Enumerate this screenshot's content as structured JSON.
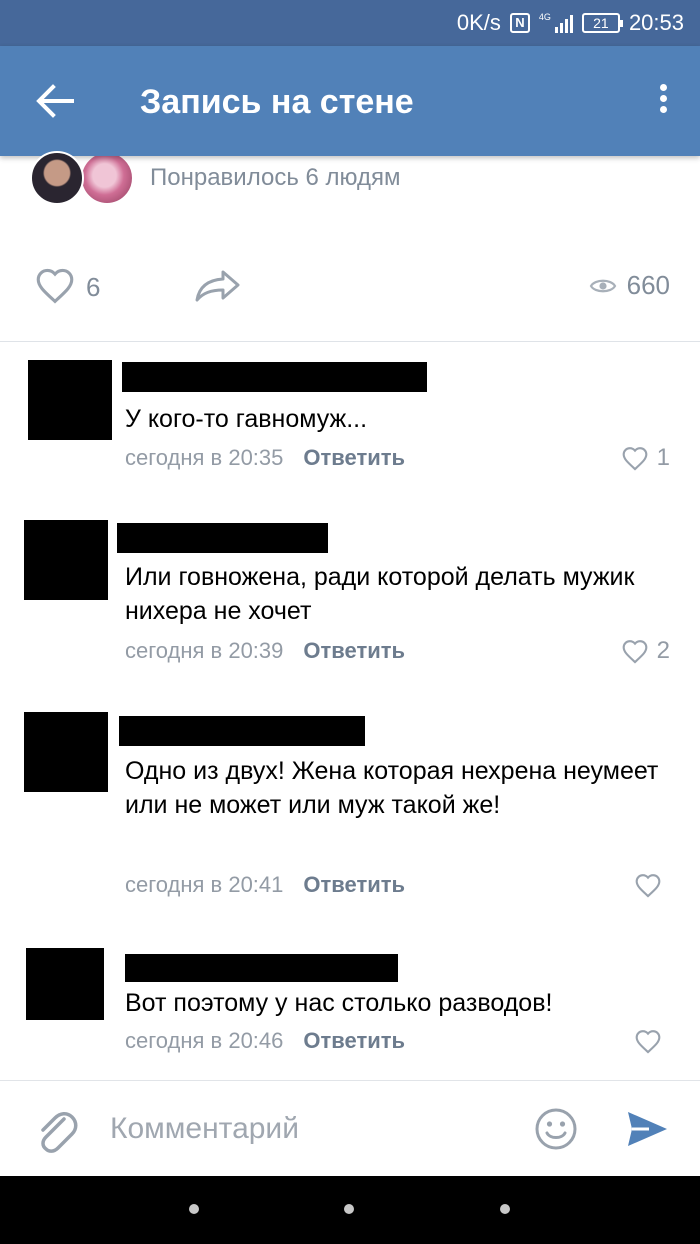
{
  "status_bar": {
    "speed": "0K/s",
    "nfc": "N",
    "network": "4G",
    "battery": "21",
    "time": "20:53",
    "icons": [
      "nfc-icon",
      "signal-icon",
      "battery-icon"
    ]
  },
  "app_bar": {
    "title": "Запись на стене",
    "back_icon": "arrow-left-icon",
    "menu_icon": "more-vert-icon"
  },
  "post": {
    "liked_by_text": "Понравилось 6 людям",
    "likes_count": "6",
    "views_count": "660",
    "icons": [
      "heart-icon",
      "share-icon",
      "eye-icon"
    ]
  },
  "comments": [
    {
      "text": "У кого-то гавномуж...",
      "time": "сегодня в 20:35",
      "reply_label": "Ответить",
      "likes": "1"
    },
    {
      "text": "Или говножена, ради которой делать мужик нихера не хочет",
      "time": "сегодня в 20:39",
      "reply_label": "Ответить",
      "likes": "2"
    },
    {
      "text": "Одно из двух! Жена которая нехрена неумеет или не может или муж такой же!",
      "time": "сегодня в 20:41",
      "reply_label": "Ответить",
      "likes": ""
    },
    {
      "text": "Вот поэтому у нас столько разводов!",
      "time": "сегодня в 20:46",
      "reply_label": "Ответить",
      "likes": ""
    }
  ],
  "composer": {
    "placeholder": "Комментарий",
    "value": "",
    "icons": [
      "paperclip-icon",
      "smiley-icon",
      "send-icon"
    ]
  },
  "colors": {
    "status_bar": "#46689a",
    "app_bar": "#5181b8",
    "accent": "#5181b8",
    "secondary_text": "#818c99",
    "redaction": "#000000"
  }
}
